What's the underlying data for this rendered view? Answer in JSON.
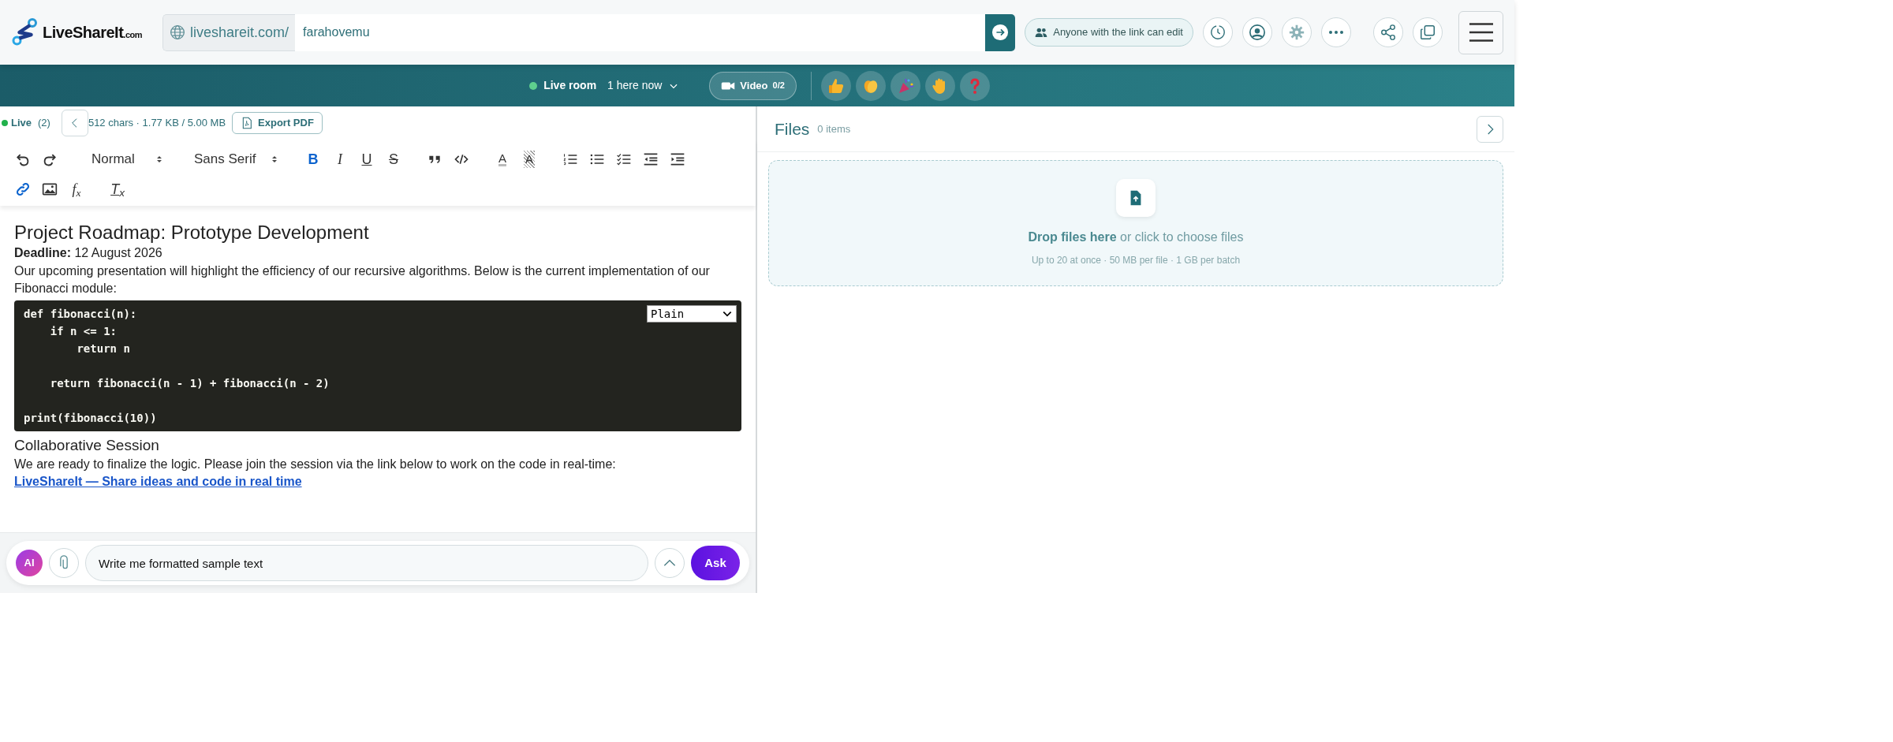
{
  "header": {
    "logo": {
      "name": "LiveShareIt",
      "suffix": ".com"
    },
    "url": {
      "prefix": "liveshareit.com/",
      "value": "farahovemu"
    },
    "access": "Anyone with the link can edit",
    "icons": [
      {
        "kind": "history"
      },
      {
        "kind": "profile"
      },
      {
        "kind": "settings"
      },
      {
        "kind": "more"
      },
      {
        "kind": "share"
      },
      {
        "kind": "copy"
      },
      {
        "kind": "menu"
      }
    ]
  },
  "live_bar": {
    "label": "Live room",
    "presence": "1 here now",
    "video": {
      "label": "Video",
      "count": "0/2"
    },
    "reactions": [
      {
        "kind": "thumbs"
      },
      {
        "kind": "clap"
      },
      {
        "kind": "party"
      },
      {
        "kind": "hand"
      },
      {
        "kind": "question"
      }
    ]
  },
  "editor": {
    "status": {
      "label": "Live",
      "count": "(2)",
      "online": true
    },
    "stats": "512 chars · 1.77 KB / 5.00 MB",
    "export": "Export PDF",
    "toolbar": {
      "items": [
        {
          "kind": "undo",
          "active": false
        },
        {
          "kind": "redo",
          "active": false
        },
        {
          "kind": "select",
          "value": "Normal"
        },
        {
          "kind": "select",
          "value": "Sans Serif"
        },
        {
          "kind": "bold",
          "glyph": "B",
          "active": true
        },
        {
          "kind": "italic",
          "glyph": "I",
          "active": false
        },
        {
          "kind": "underline",
          "glyph": "U",
          "active": false
        },
        {
          "kind": "strike",
          "glyph": "S",
          "active": false
        },
        {
          "kind": "blockquote",
          "active": false
        },
        {
          "kind": "code",
          "active": false
        },
        {
          "kind": "color",
          "glyph": "A",
          "active": false
        },
        {
          "kind": "background",
          "glyph": "A",
          "active": false
        },
        {
          "kind": "ol",
          "active": false
        },
        {
          "kind": "ul",
          "active": false
        },
        {
          "kind": "tasks",
          "active": false
        },
        {
          "kind": "outdent",
          "active": false
        },
        {
          "kind": "indent",
          "active": false
        },
        {
          "kind": "link",
          "active": true
        },
        {
          "kind": "image",
          "active": false
        },
        {
          "kind": "formula",
          "glyph": "f$_{x}$",
          "active": false
        },
        {
          "kind": "clean",
          "glyph": "T$_{x}$",
          "active": false
        }
      ]
    },
    "document": [
      {
        "kind": "heading",
        "text": "Project Roadmap: Prototype Development"
      },
      {
        "kind": "paragraph",
        "text": "**Deadline:** 12 August 2026"
      },
      {
        "kind": "paragraph",
        "text": "Our upcoming presentation will highlight the efficiency of our recursive algorithms. Below is the current implementation of our Fibonacci module:"
      },
      {
        "kind": "code",
        "language": "Plain",
        "code": "def fibonacci(n):\n    if n <= 1:\n        return n\n\n    return fibonacci(n - 1) + fibonacci(n - 2)\n\nprint(fibonacci(10))"
      },
      {
        "kind": "subheading",
        "text": "Collaborative Session"
      },
      {
        "kind": "paragraph",
        "text": "We are ready to finalize the logic. Please join the session via the link below to work on the code in real-time:"
      },
      {
        "kind": "link",
        "text": "LiveShareIt — Share ideas and code in real time"
      }
    ]
  },
  "ai": {
    "badge": "AI",
    "value": "Write me formatted sample text",
    "button": "Ask"
  },
  "files": {
    "title": "Files",
    "count": "0 items",
    "drop": {
      "title": "Drop files here",
      "text": "or click to choose files",
      "limits": "Up to 20 at once · 50 MB per file · 1 GB per batch"
    }
  }
}
